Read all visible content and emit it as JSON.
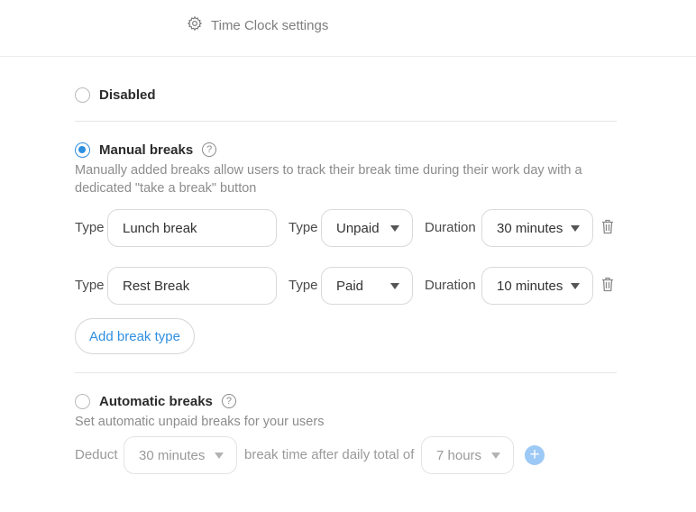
{
  "header": {
    "settings_label": "Time Clock settings",
    "settings_icon": "gear-icon"
  },
  "options": {
    "disabled": {
      "label": "Disabled",
      "selected": false
    },
    "manual": {
      "label": "Manual breaks",
      "selected": true,
      "help_glyph": "?",
      "description": "Manually added breaks allow users to track their break time during their work day with a dedicated \"take a break\" button",
      "breaks": [
        {
          "type_label": "Type",
          "name": "Lunch break",
          "pay_label": "Type",
          "pay": "Unpaid",
          "duration_label": "Duration",
          "duration": "30 minutes"
        },
        {
          "type_label": "Type",
          "name": "Rest Break",
          "pay_label": "Type",
          "pay": "Paid",
          "duration_label": "Duration",
          "duration": "10 minutes"
        }
      ],
      "add_label": "Add break type"
    },
    "automatic": {
      "label": "Automatic breaks",
      "selected": false,
      "help_glyph": "?",
      "description": "Set automatic unpaid breaks for your users",
      "deduct_label": "Deduct",
      "deduct_value": "30 minutes",
      "after_label": "break time after daily total of",
      "total_value": "7 hours",
      "add_glyph": "+"
    }
  },
  "colors": {
    "accent": "#2f8fe0",
    "accent_light": "#9cc9f5",
    "divider": "#e6e6e6"
  }
}
